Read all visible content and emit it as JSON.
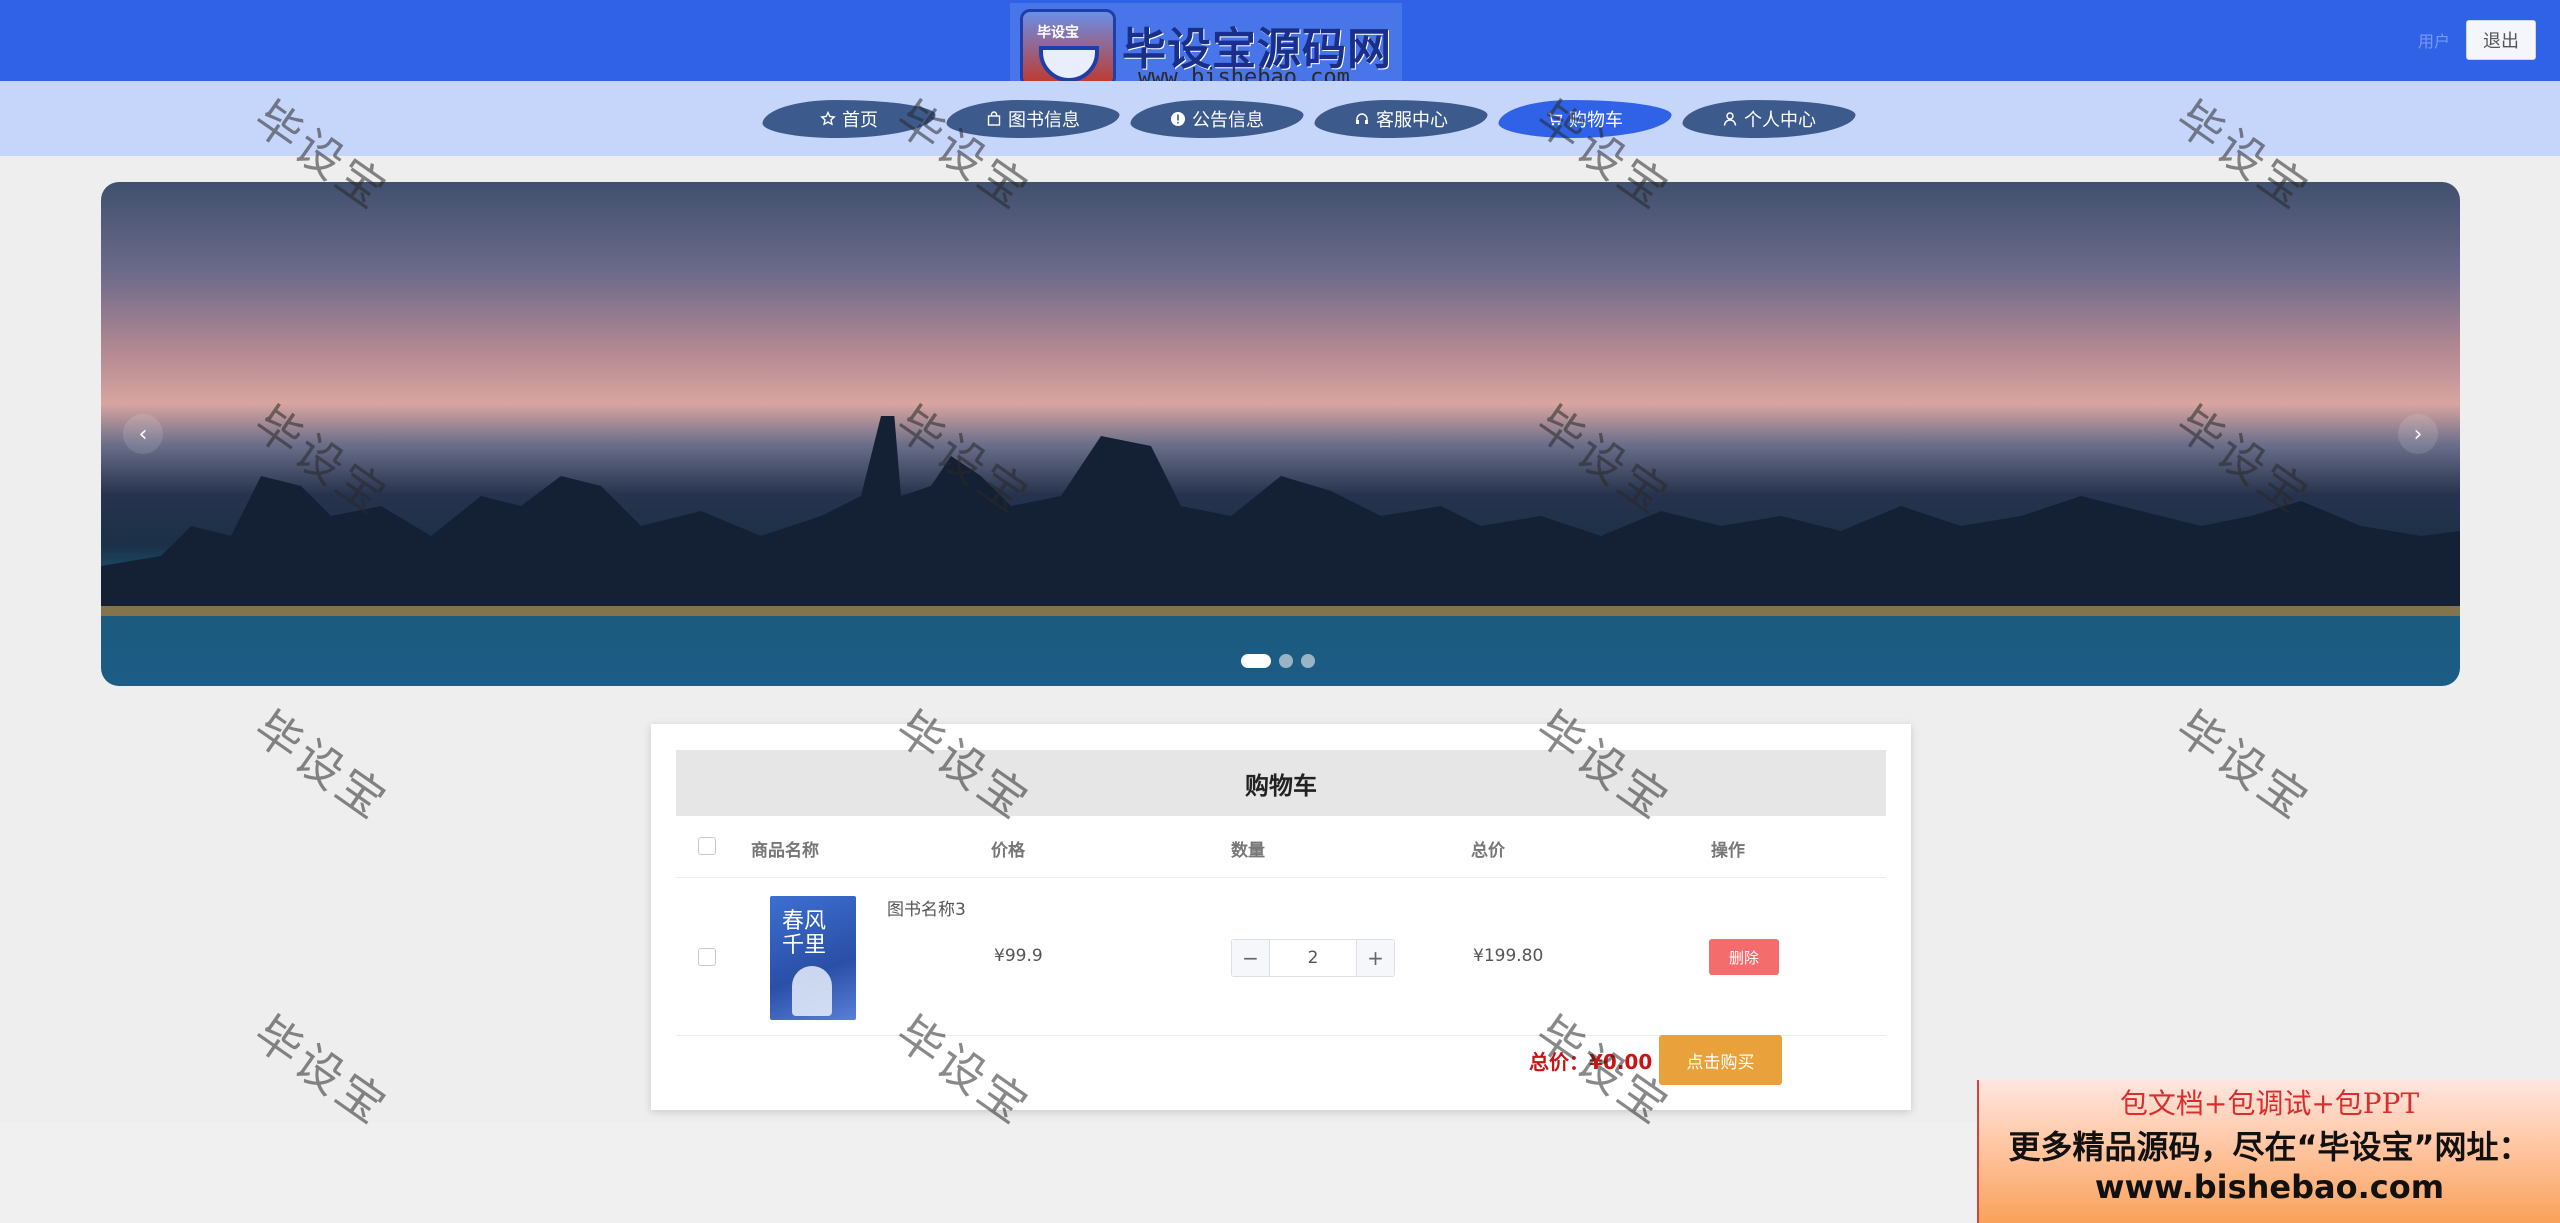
{
  "logo": {
    "title": "毕设宝源码网",
    "url": "www.bishebao.com",
    "badge": "毕设宝"
  },
  "header": {
    "user_label": "用户",
    "logout_label": "退出"
  },
  "nav": [
    {
      "label": "首页",
      "icon": "star-icon"
    },
    {
      "label": "图书信息",
      "icon": "bag-icon"
    },
    {
      "label": "公告信息",
      "icon": "info-icon"
    },
    {
      "label": "客服中心",
      "icon": "headset-icon"
    },
    {
      "label": "购物车",
      "icon": "cart-icon",
      "active": true
    },
    {
      "label": "个人中心",
      "icon": "user-icon"
    }
  ],
  "banner": {
    "arrow_left": "‹",
    "arrow_right": "›",
    "slide_count": 3,
    "active_slide": 1
  },
  "cart": {
    "title": "购物车",
    "columns": [
      "商品名称",
      "价格",
      "数量",
      "总价",
      "操作"
    ],
    "items": [
      {
        "name": "图书名称3",
        "cover_text": "春风\n千里",
        "price": "¥99.9",
        "quantity": "2",
        "total": "¥199.80",
        "delete_label": "删除"
      }
    ],
    "total_label": "总价：¥0.00",
    "buy_label": "点击购买"
  },
  "watermark_text": "毕设宝",
  "promo": {
    "line1": "包文档+包调试+包PPT",
    "line2": "更多精品源码，尽在“毕设宝”网址：",
    "line3": "www.bishebao.com"
  }
}
